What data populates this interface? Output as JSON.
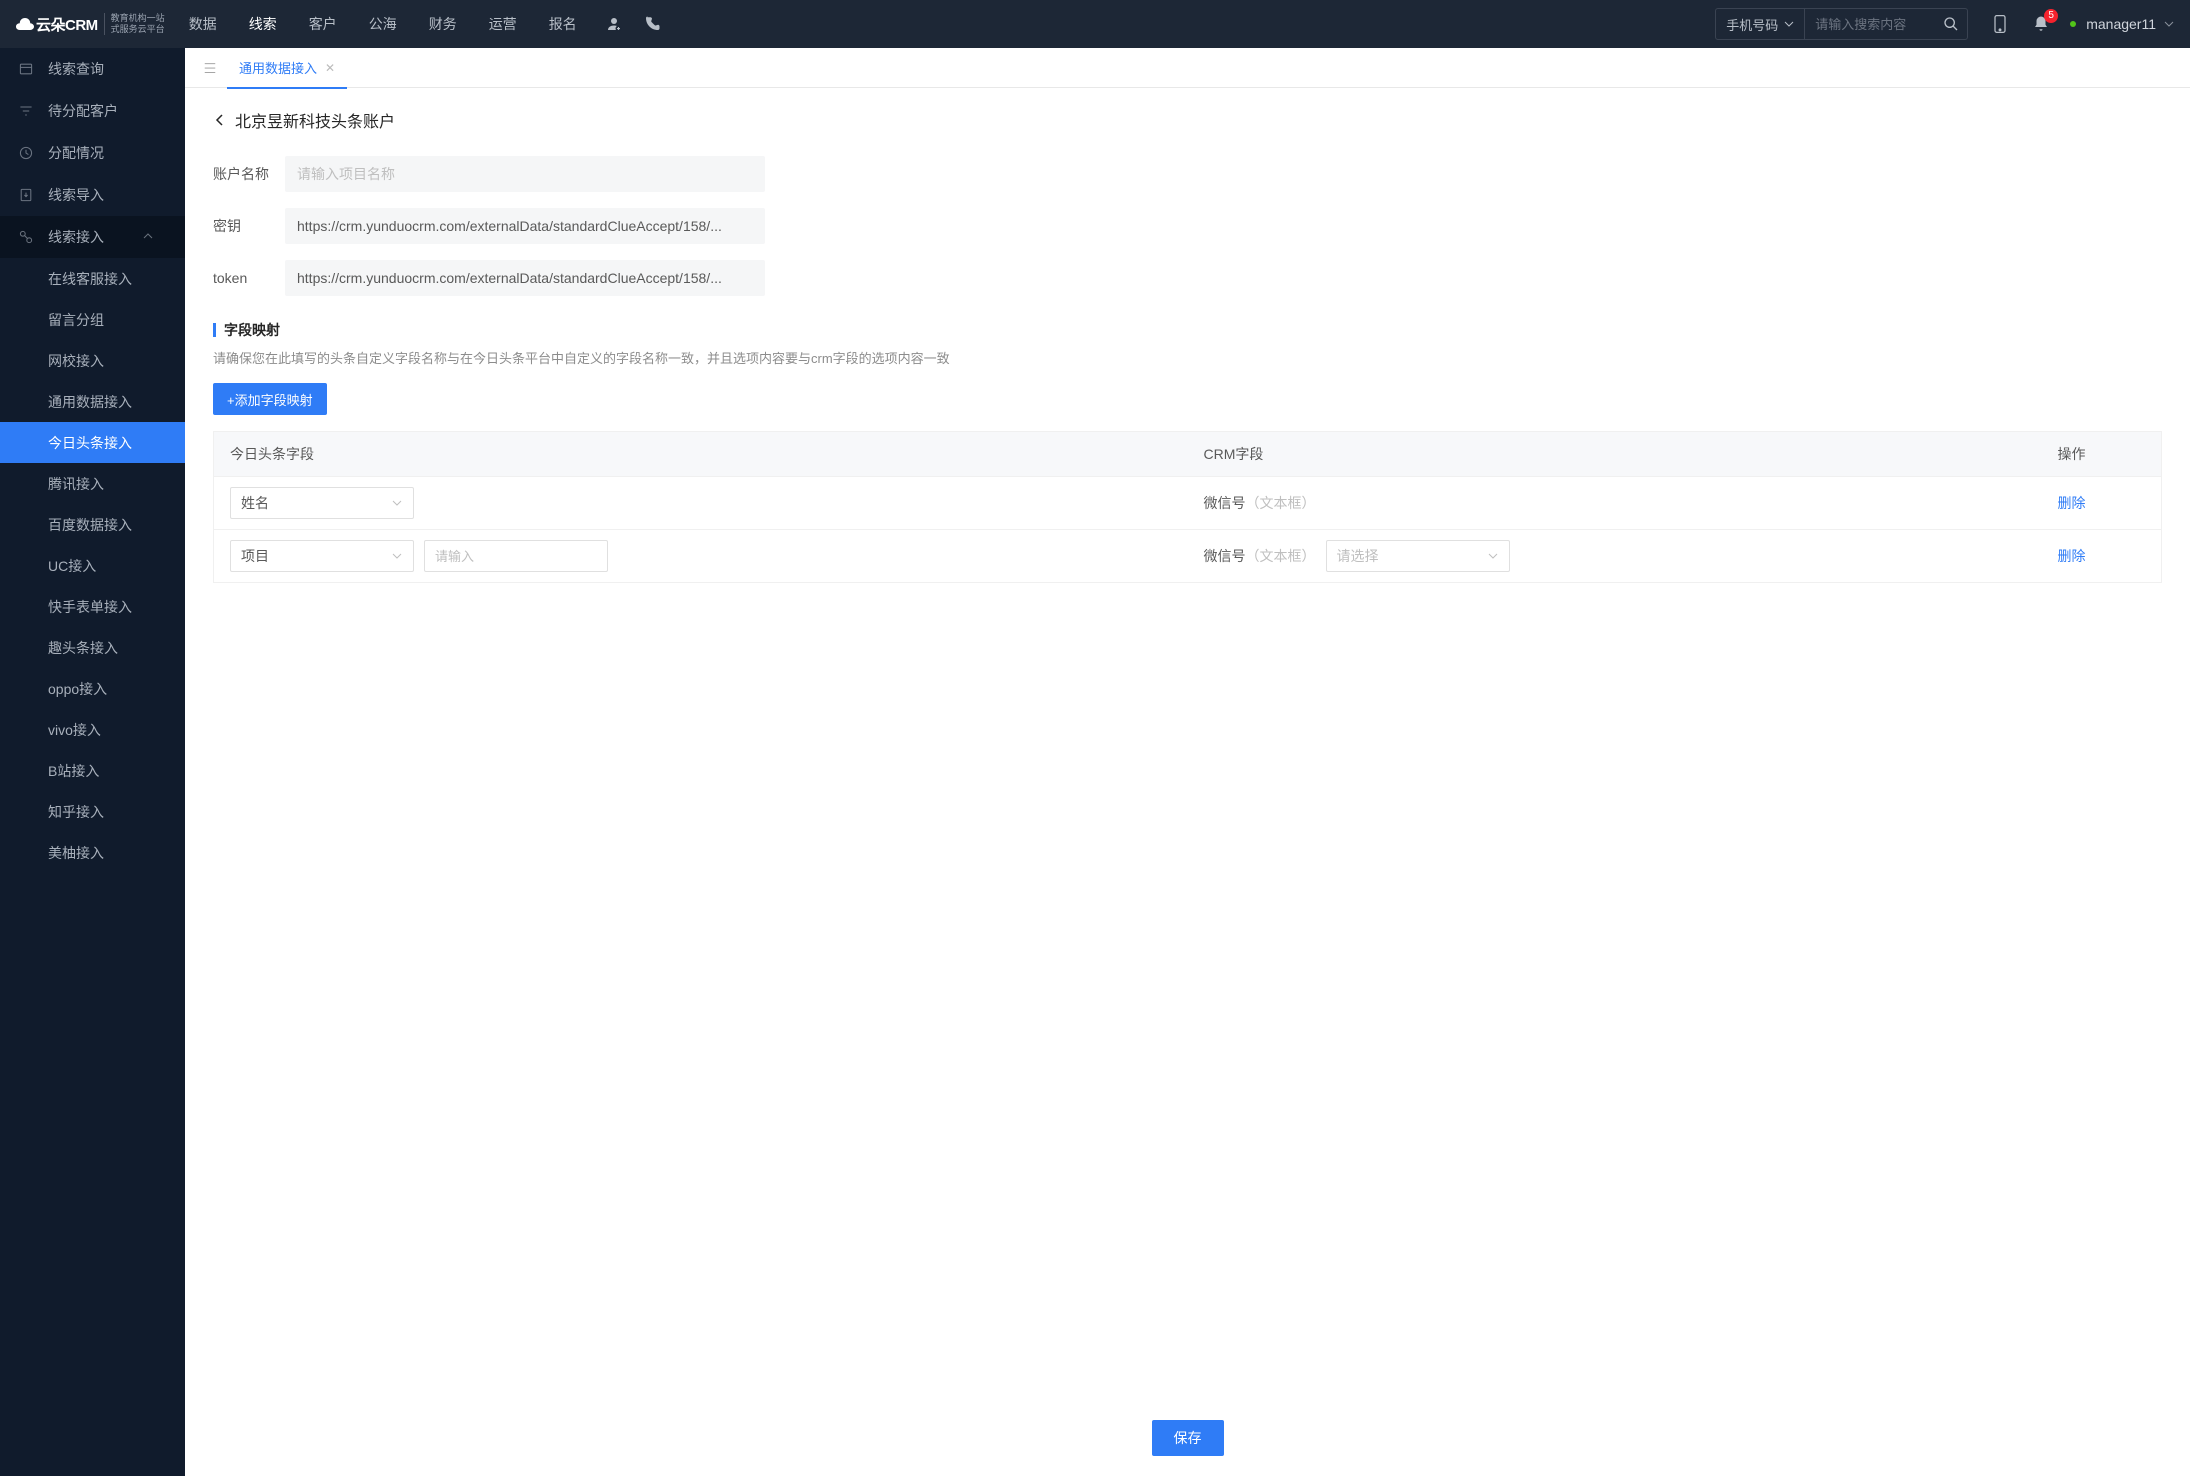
{
  "header": {
    "logo_text": "云朵CRM",
    "logo_sub1": "教育机构一站",
    "logo_sub2": "式服务云平台",
    "nav": [
      "数据",
      "线索",
      "客户",
      "公海",
      "财务",
      "运营",
      "报名"
    ],
    "nav_active_index": 1,
    "search_select": "手机号码",
    "search_placeholder": "请输入搜索内容",
    "badge": "5",
    "username": "manager11"
  },
  "sidebar": {
    "items": [
      {
        "label": "线索查询"
      },
      {
        "label": "待分配客户"
      },
      {
        "label": "分配情况"
      },
      {
        "label": "线索导入"
      }
    ],
    "group_label": "线索接入",
    "subs": [
      "在线客服接入",
      "留言分组",
      "网校接入",
      "通用数据接入",
      "今日头条接入",
      "腾讯接入",
      "百度数据接入",
      "UC接入",
      "快手表单接入",
      "趣头条接入",
      "oppo接入",
      "vivo接入",
      "B站接入",
      "知乎接入",
      "美柚接入"
    ],
    "sub_active_index": 4
  },
  "tabs": {
    "active": "通用数据接入"
  },
  "page": {
    "breadcrumb": "北京昱新科技头条账户",
    "form": {
      "account_label": "账户名称",
      "account_placeholder": "请输入项目名称",
      "secret_label": "密钥",
      "secret_value": "https://crm.yunduocrm.com/externalData/standardClueAccept/158/...",
      "token_label": "token",
      "token_value": "https://crm.yunduocrm.com/externalData/standardClueAccept/158/..."
    },
    "mapping": {
      "title": "字段映射",
      "desc": "请确保您在此填写的头条自定义字段名称与在今日头条平台中自定义的字段名称一致，并且选项内容要与crm字段的选项内容一致",
      "add_label": "+添加字段映射",
      "cols": {
        "c1": "今日头条字段",
        "c2": "CRM字段",
        "c3": "操作"
      },
      "rows": [
        {
          "field": "姓名",
          "crm": "微信号",
          "crm_hint": "（文本框）",
          "del": "删除",
          "has_input": false,
          "has_sel": false
        },
        {
          "field": "项目",
          "crm": "微信号",
          "crm_hint": "（文本框）",
          "del": "删除",
          "has_input": true,
          "input_ph": "请输入",
          "has_sel": true,
          "sel_ph": "请选择"
        }
      ]
    },
    "save_label": "保存"
  }
}
